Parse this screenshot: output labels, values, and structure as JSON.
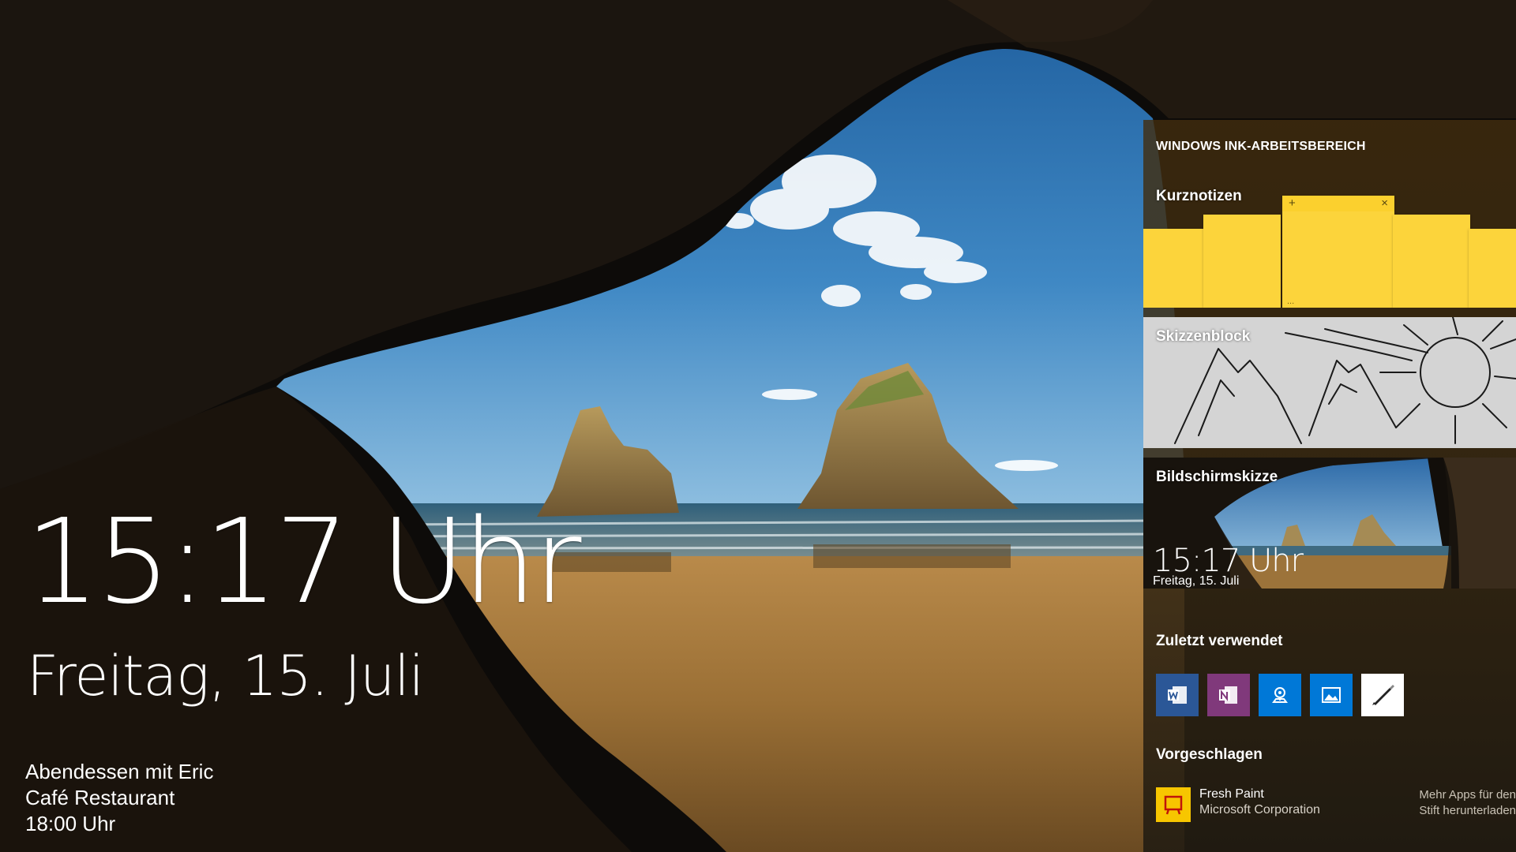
{
  "lock_screen": {
    "time": "15:17 Uhr",
    "date": "Freitag, 15. Juli",
    "event": {
      "title": "Abendessen mit Eric",
      "location": "Café Restaurant",
      "time": "18:00 Uhr"
    }
  },
  "ink_workspace": {
    "title": "WINDOWS INK-ARBEITSBEREICH",
    "sticky_notes": {
      "label": "Kurznotizen",
      "add_symbol": "+",
      "close_symbol": "×",
      "note_text": "..."
    },
    "sketchpad": {
      "label": "Skizzenblock"
    },
    "screen_sketch": {
      "label": "Bildschirmskizze",
      "preview_time": "15:17 Uhr",
      "preview_date": "Freitag, 15. Juli"
    },
    "recently_used": {
      "label": "Zuletzt verwendet",
      "apps": [
        {
          "icon": "word-icon",
          "color": "#2b5797"
        },
        {
          "icon": "onenote-icon",
          "color": "#80397b"
        },
        {
          "icon": "maps-icon",
          "color": "#0078d7"
        },
        {
          "icon": "photos-icon",
          "color": "#0078d7"
        },
        {
          "icon": "pen-app-icon",
          "color": "#ffffff"
        }
      ]
    },
    "suggested": {
      "label": "Vorgeschlagen",
      "app_name": "Fresh Paint",
      "publisher": "Microsoft Corporation",
      "icon": "fresh-paint-icon",
      "more_apps_line1": "Mehr Apps für den",
      "more_apps_line2": "Stift herunterladen"
    }
  },
  "colors": {
    "sticky_yellow": "#fcd43b",
    "panel_bg": "#3a2a12",
    "sky": "#2e6fb0",
    "sand": "#a57a3d"
  }
}
